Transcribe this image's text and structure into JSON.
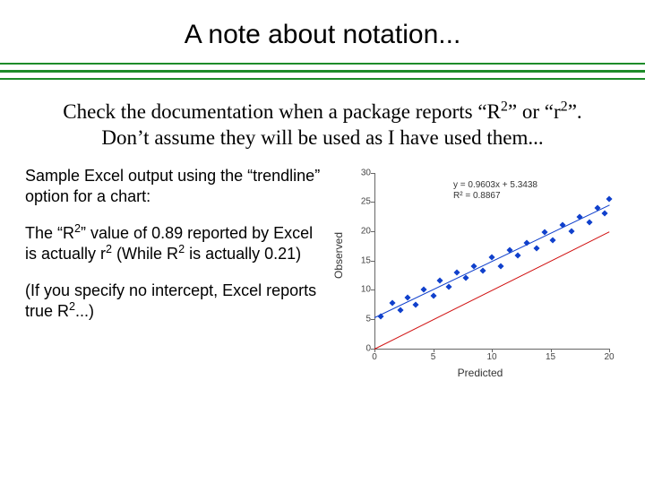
{
  "title": "A note about notation...",
  "subhead_parts": {
    "p1": "Check the documentation when a package reports “R",
    "p2": "” or “r",
    "p3": "”.  Don’t assume they will be used as I have used them..."
  },
  "sup2": "2",
  "left": {
    "p1": "Sample Excel output using the “trendline” option for a chart:",
    "p2a": "The “R",
    "p2b": "” value of 0.89 reported by Excel is actually r",
    "p2c": " (While R",
    "p2d": " is actually 0.21)",
    "p3a": "(If you specify no intercept, Excel reports true R",
    "p3b": "...)"
  },
  "chart_data": {
    "type": "scatter",
    "title": "",
    "xlabel": "Predicted",
    "ylabel": "Observed",
    "xlim": [
      0,
      20
    ],
    "ylim": [
      0,
      30
    ],
    "xticks": [
      0,
      5,
      10,
      15,
      20
    ],
    "yticks": [
      0,
      5,
      10,
      15,
      20,
      25,
      30
    ],
    "annotation": {
      "eq": "y = 0.9603x + 5.3438",
      "r2": "R² = 0.8867"
    },
    "series": [
      {
        "name": "identity",
        "type": "line",
        "color": "#d01010",
        "points": [
          [
            0,
            0
          ],
          [
            20,
            20
          ]
        ]
      },
      {
        "name": "trend",
        "type": "line",
        "color": "#1040cc",
        "points": [
          [
            0,
            5.34
          ],
          [
            20,
            24.55
          ]
        ]
      },
      {
        "name": "data",
        "type": "scatter",
        "color": "#1040cc",
        "points": [
          [
            0.5,
            5.5
          ],
          [
            1.5,
            7.8
          ],
          [
            2.2,
            6.5
          ],
          [
            2.8,
            8.6
          ],
          [
            3.5,
            7.5
          ],
          [
            4.2,
            10.0
          ],
          [
            5.0,
            9.0
          ],
          [
            5.6,
            11.5
          ],
          [
            6.3,
            10.5
          ],
          [
            7.0,
            13.0
          ],
          [
            7.8,
            12.0
          ],
          [
            8.5,
            14.0
          ],
          [
            9.2,
            13.2
          ],
          [
            10.0,
            15.5
          ],
          [
            10.8,
            14.0
          ],
          [
            11.5,
            16.8
          ],
          [
            12.2,
            15.8
          ],
          [
            13.0,
            18.0
          ],
          [
            13.8,
            17.0
          ],
          [
            14.5,
            19.8
          ],
          [
            15.2,
            18.5
          ],
          [
            16.0,
            21.0
          ],
          [
            16.8,
            20.0
          ],
          [
            17.5,
            22.5
          ],
          [
            18.3,
            21.5
          ],
          [
            19.0,
            24.0
          ],
          [
            19.6,
            23.0
          ],
          [
            20.0,
            25.5
          ]
        ]
      }
    ]
  }
}
